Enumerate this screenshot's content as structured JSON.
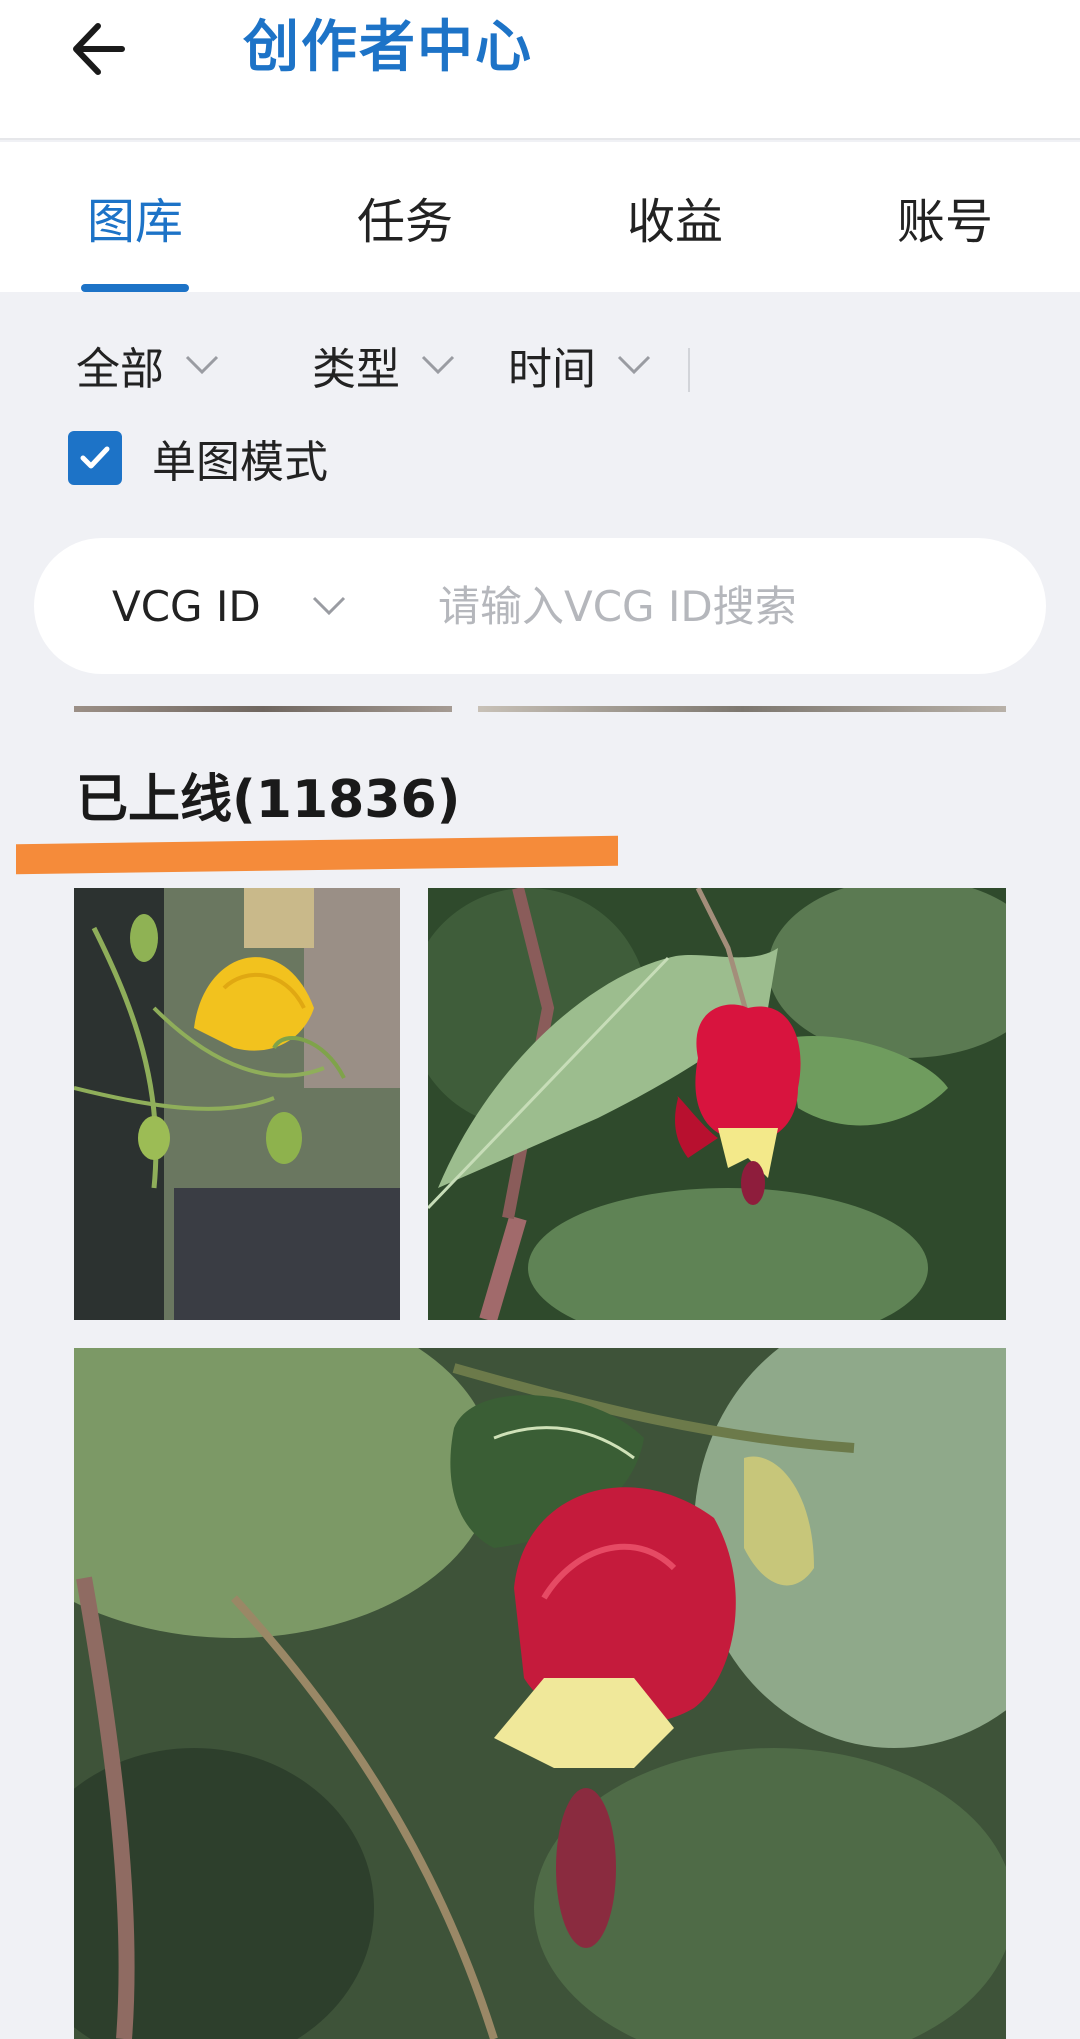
{
  "header": {
    "title": "创作者中心",
    "back_icon": "arrow-left-icon"
  },
  "tabs": [
    {
      "label": "图库",
      "active": true
    },
    {
      "label": "任务",
      "active": false
    },
    {
      "label": "收益",
      "active": false
    },
    {
      "label": "账号",
      "active": false
    }
  ],
  "filters": {
    "all_label": "全部",
    "type_label": "类型",
    "time_label": "时间",
    "chevron_icon": "chevron-down-icon"
  },
  "single_mode": {
    "label": "单图模式",
    "checked": true
  },
  "search": {
    "type_label": "VCG ID",
    "placeholder": "请输入VCG ID搜索",
    "value": ""
  },
  "section": {
    "title": "已上线(11836)"
  },
  "colors": {
    "accent": "#1d73c7",
    "highlight": "#f58b3a",
    "background": "#f0f1f5"
  }
}
